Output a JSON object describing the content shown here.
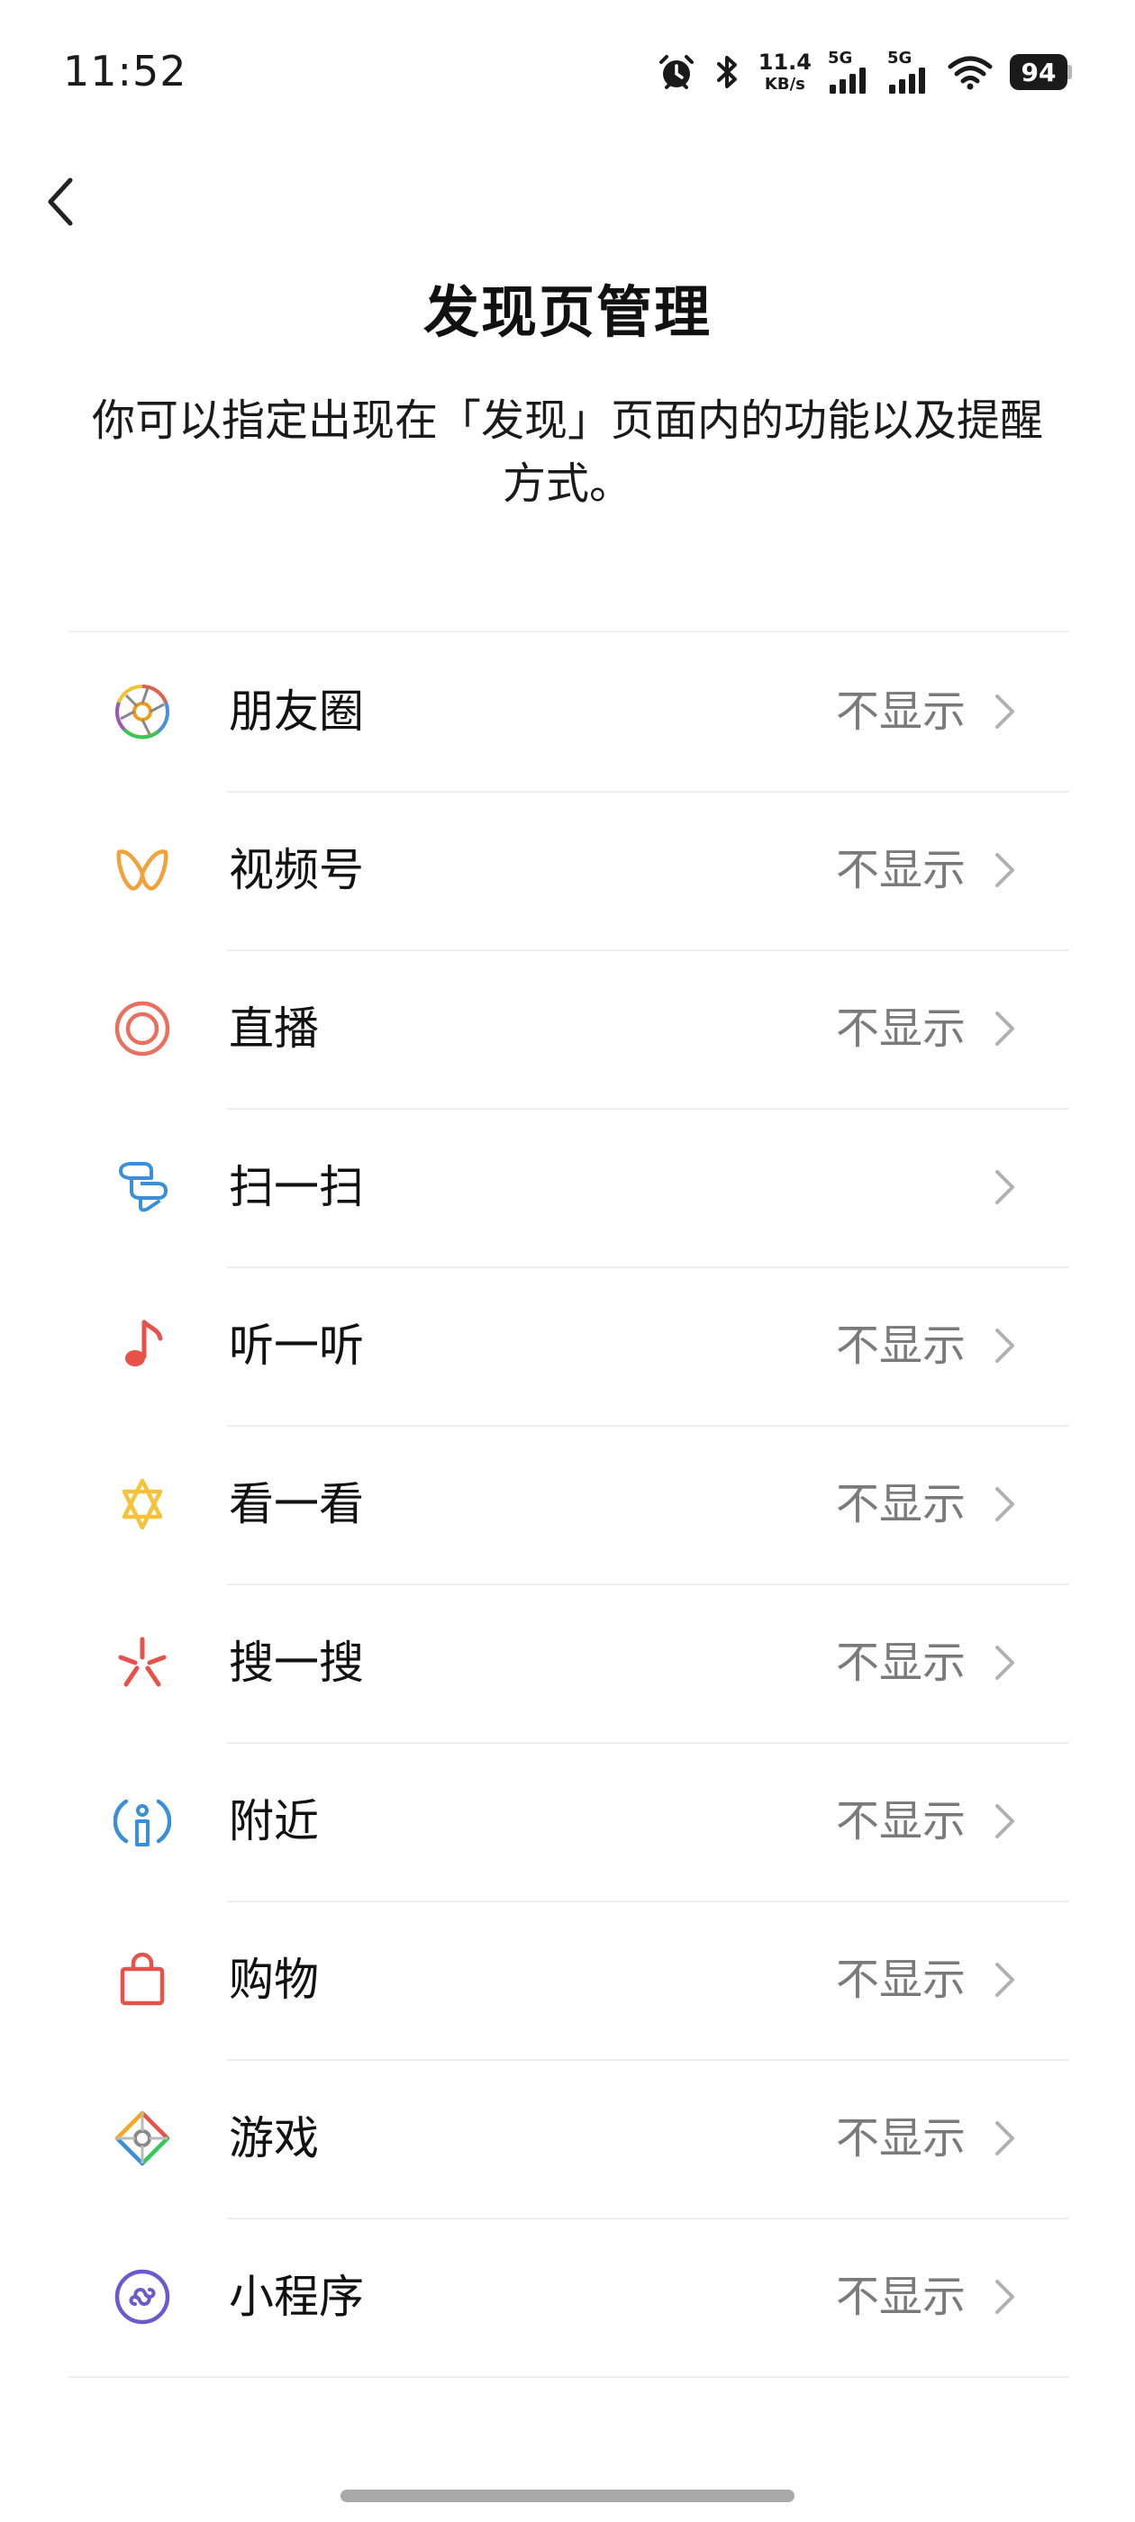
{
  "status_bar": {
    "time": "11:52",
    "net_speed_value": "11.4",
    "net_speed_unit": "KB/s",
    "sim1_label": "5G",
    "sim2_label": "5G",
    "battery_level": "94"
  },
  "header": {
    "title": "发现页管理",
    "description": "你可以指定出现在「发现」页面内的功能以及提醒方式。"
  },
  "list": {
    "items": [
      {
        "label": "朋友圈",
        "value": "不显示",
        "icon": "moments-icon"
      },
      {
        "label": "视频号",
        "value": "不显示",
        "icon": "channels-icon"
      },
      {
        "label": "直播",
        "value": "不显示",
        "icon": "live-icon"
      },
      {
        "label": "扫一扫",
        "value": "",
        "icon": "scan-icon"
      },
      {
        "label": "听一听",
        "value": "不显示",
        "icon": "music-note-icon"
      },
      {
        "label": "看一看",
        "value": "不显示",
        "icon": "top-stories-icon"
      },
      {
        "label": "搜一搜",
        "value": "不显示",
        "icon": "search-star-icon"
      },
      {
        "label": "附近",
        "value": "不显示",
        "icon": "nearby-icon"
      },
      {
        "label": "购物",
        "value": "不显示",
        "icon": "shopping-bag-icon"
      },
      {
        "label": "游戏",
        "value": "不显示",
        "icon": "games-icon"
      },
      {
        "label": "小程序",
        "value": "不显示",
        "icon": "mini-programs-icon"
      }
    ]
  },
  "colors": {
    "value_text": "#7a7a7a",
    "chevron": "#b0b0b0",
    "divider": "#ececec"
  }
}
